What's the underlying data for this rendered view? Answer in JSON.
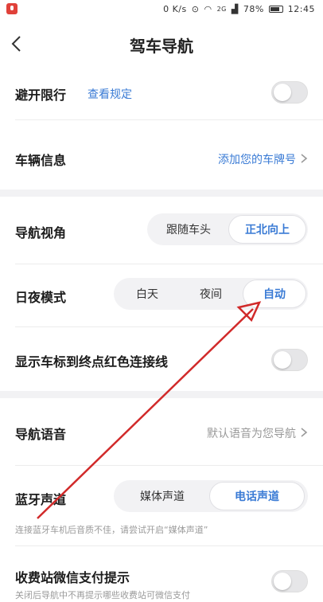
{
  "status_bar": {
    "net_speed": "0 K/s",
    "signal_label": "2G",
    "battery_pct": "78%",
    "time": "12:45"
  },
  "nav": {
    "title": "驾车导航"
  },
  "avoid_restriction": {
    "label": "避开限行",
    "link": "查看规定",
    "enabled": false
  },
  "vehicle_info": {
    "label": "车辆信息",
    "action": "添加您的车牌号"
  },
  "nav_view": {
    "label": "导航视角",
    "options": [
      "跟随车头",
      "正北向上"
    ],
    "selected": "正北向上"
  },
  "day_night": {
    "label": "日夜模式",
    "options": [
      "白天",
      "夜间",
      "自动"
    ],
    "selected": "自动"
  },
  "red_line": {
    "label": "显示车标到终点红色连接线",
    "enabled": false
  },
  "nav_voice": {
    "label": "导航语音",
    "value": "默认语音为您导航"
  },
  "bluetooth": {
    "label": "蓝牙声道",
    "options": [
      "媒体声道",
      "电话声道"
    ],
    "selected": "电话声道",
    "hint": "连接蓝牙车机后音质不佳，请尝试开启“媒体声道”"
  },
  "toll_wechat": {
    "label": "收费站微信支付提示",
    "hint": "关闭后导航中不再提示哪些收费站可微信支付",
    "enabled": false
  },
  "colors": {
    "accent": "#3a7bd5",
    "annotation_arrow": "#d12a2a"
  }
}
